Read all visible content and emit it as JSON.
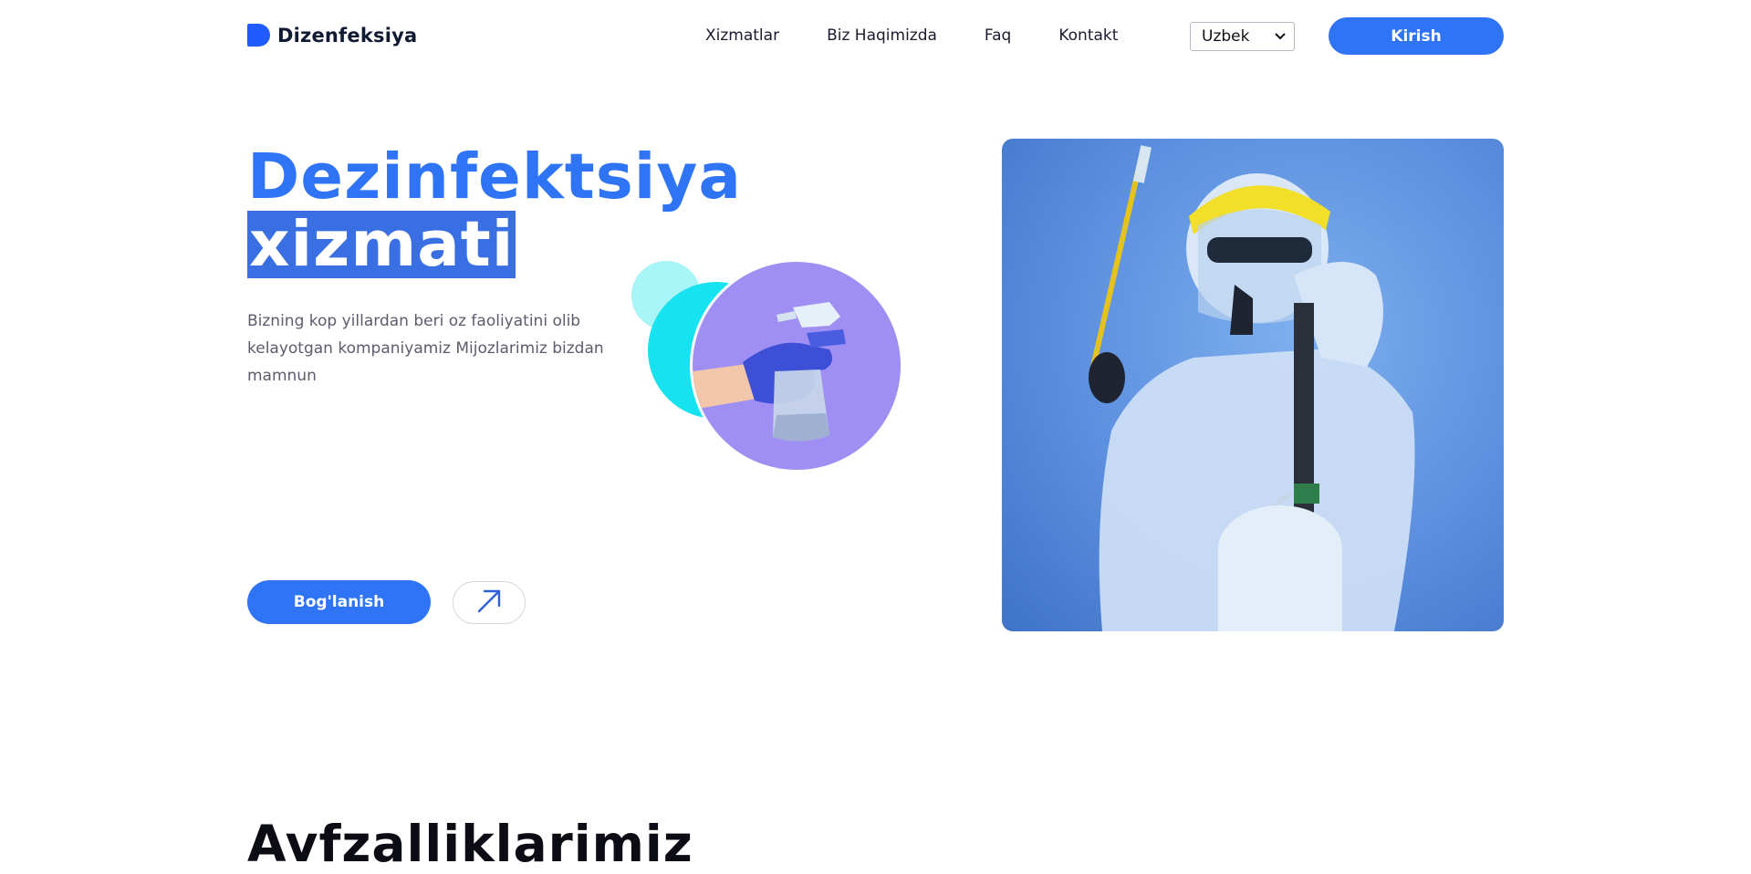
{
  "header": {
    "brand": "Dizenfeksiya",
    "nav": [
      {
        "label": "Xizmatlar"
      },
      {
        "label": "Biz Haqimizda"
      },
      {
        "label": "Faq"
      },
      {
        "label": "Kontakt"
      }
    ],
    "language": {
      "selected": "Uzbek"
    },
    "login_label": "Kirish"
  },
  "hero": {
    "title_line1": "Dezinfektsiya",
    "title_line2": "xizmati",
    "description": "Bizning kop yillardan beri oz faoliyatini olib kelayotgan kompaniyamiz Mijozlarimiz bizdan mamnun",
    "contact_label": "Bog'lanish",
    "arrow_icon": "arrow-up-right-icon"
  },
  "section": {
    "title": "Avfzalliklarimiz"
  },
  "colors": {
    "accent": "#2f74f5",
    "highlight": "#3a6ee3",
    "cyan": "#17e3f0",
    "purple": "#9f8ff3"
  }
}
